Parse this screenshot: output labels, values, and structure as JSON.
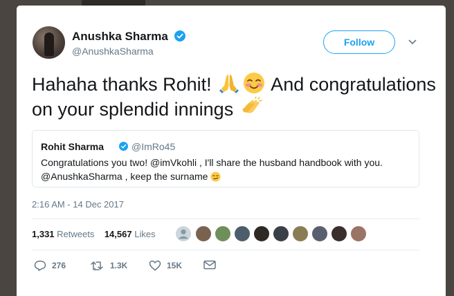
{
  "tweet": {
    "author_name": "Anushka Sharma",
    "author_handle": "@AnushkaSharma",
    "follow_label": "Follow",
    "text_part1": "Hahaha thanks Rohit! ",
    "text_part2": " And congratulations on your splendid innings ",
    "timestamp": "2:16 AM - 14 Dec 2017"
  },
  "quoted": {
    "name": "Rohit Sharma",
    "handle": "@ImRo45",
    "text": "Congratulations you two! @imVkohli , I'll share the husband handbook with you. @AnushkaSharma , keep the surname "
  },
  "stats": {
    "retweets_count": "1,331",
    "retweets_label": "Retweets",
    "likes_count": "14,567",
    "likes_label": "Likes"
  },
  "actions": {
    "replies": "276",
    "retweets": "1.3K",
    "likes": "15K"
  },
  "colors": {
    "accent": "#1da1f2",
    "text": "#14171a",
    "muted": "#657786"
  }
}
